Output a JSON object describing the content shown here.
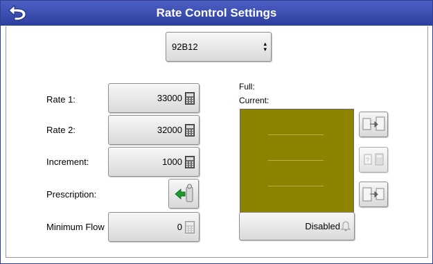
{
  "window": {
    "title": "Rate Control Settings",
    "colors": {
      "titlebar": "#3447aa",
      "panel": "#8c8300"
    }
  },
  "product_select": {
    "value": "92B12"
  },
  "rate1": {
    "label": "Rate 1:",
    "value": "33000"
  },
  "rate2": {
    "label": "Rate 2:",
    "value": "32000"
  },
  "increment": {
    "label": "Increment:",
    "value": "1000"
  },
  "prescription": {
    "label": "Prescription:"
  },
  "minimum_flow": {
    "label": "Minimum Flow",
    "value": "0"
  },
  "tank": {
    "full_label": "Full:",
    "current_label": "Current:"
  },
  "alarm": {
    "value": "Disabled"
  },
  "icons": {
    "back": "back-arrow-icon",
    "calculator": "calculator-icon",
    "prescription": "prescription-import-icon",
    "tank_fill": "tank-fill-icon",
    "tank_info": "tank-info-calculator-icon",
    "tank_empty": "tank-empty-icon",
    "alarm": "alarm-bell-icon"
  }
}
